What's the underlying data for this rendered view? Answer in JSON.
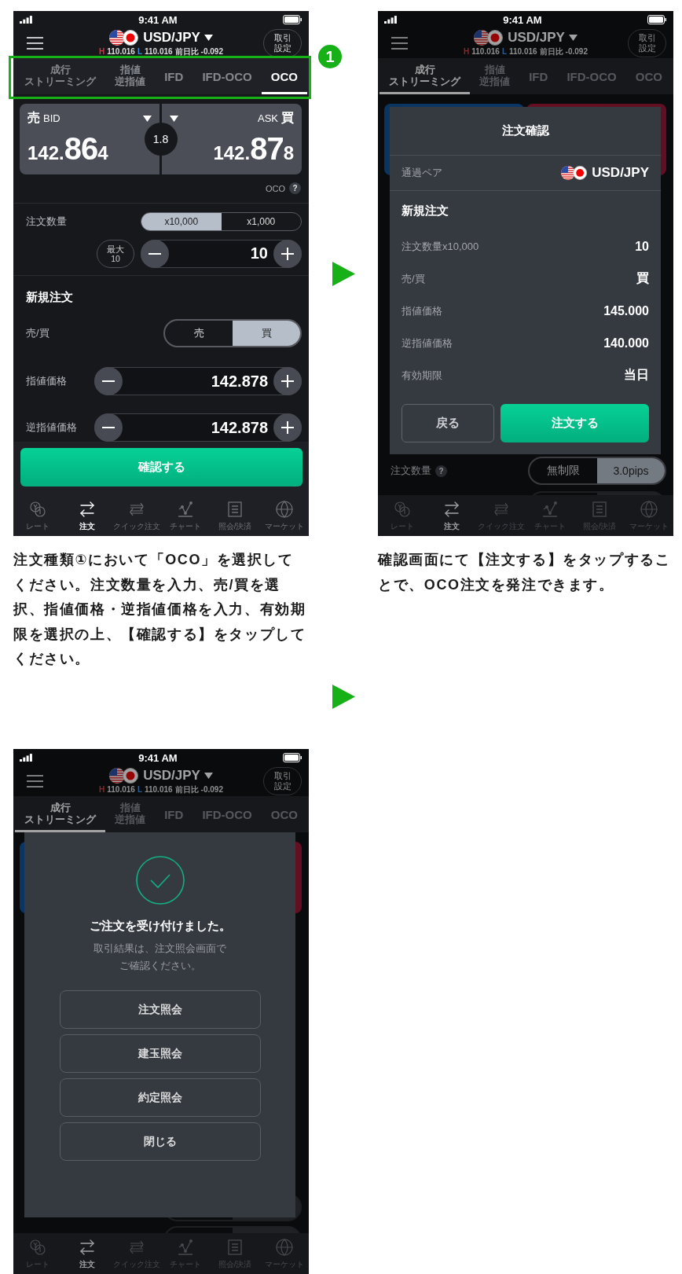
{
  "screens": [
    {
      "kind": "order",
      "status_bar": {
        "time": "9:41 AM"
      },
      "header": {
        "pair": "USD/JPY",
        "high_label": "H",
        "high": "110.016",
        "low_label": "L",
        "low": "110.016",
        "change_label": "前日比",
        "change": "-0.092",
        "settings": [
          "取引",
          "設定"
        ]
      },
      "tabs": [
        {
          "lines": [
            "成行",
            "ストリーミング"
          ],
          "selected": false
        },
        {
          "lines": [
            "指値",
            "逆指値"
          ],
          "selected": false
        },
        {
          "lines": [
            "IFD"
          ],
          "selected": false
        },
        {
          "lines": [
            "IFD-OCO"
          ],
          "selected": false
        },
        {
          "lines": [
            "OCO"
          ],
          "selected": true
        }
      ],
      "annotation": {
        "badge": "1"
      },
      "quote": {
        "bid": {
          "side": "売",
          "label": "BID",
          "price": [
            "142.",
            "86",
            "4"
          ]
        },
        "spread": "1.8",
        "ask": {
          "label": "ASK",
          "side": "買",
          "price": [
            "142.",
            "87",
            "8"
          ]
        }
      },
      "help": {
        "label": "OCO",
        "icon": "?"
      },
      "quantity": {
        "label": "注文数量",
        "units": [
          {
            "label": "x10,000",
            "selected": true
          },
          {
            "label": "x1,000",
            "selected": false
          }
        ],
        "max": [
          "最大",
          "10"
        ],
        "value": "10"
      },
      "section": "新規注文",
      "side": {
        "label": "売/買",
        "options": [
          {
            "label": "売",
            "selected": false
          },
          {
            "label": "買",
            "selected": true
          }
        ]
      },
      "prices": [
        {
          "label": "指値価格",
          "value": "142.878"
        },
        {
          "label": "逆指値価格",
          "value": "142.878"
        }
      ],
      "confirm_button": "確認する",
      "nav": [
        {
          "label": "レート",
          "selected": false
        },
        {
          "label": "注文",
          "selected": true
        },
        {
          "label": "クイック注文",
          "selected": false
        },
        {
          "label": "チャート",
          "selected": false
        },
        {
          "label": "照会/決済",
          "selected": false
        },
        {
          "label": "マーケット",
          "selected": false
        }
      ]
    },
    {
      "kind": "confirm",
      "status_bar": {
        "time": "9:41 AM"
      },
      "header": {
        "pair": "USD/JPY",
        "high_label": "H",
        "high": "110.016",
        "low_label": "L",
        "low": "110.016",
        "change_label": "前日比",
        "change": "-0.092",
        "settings": [
          "取引",
          "設定"
        ]
      },
      "tabs": [
        {
          "lines": [
            "成行",
            "ストリーミング"
          ],
          "selected": true
        },
        {
          "lines": [
            "指値",
            "逆指値"
          ],
          "selected": false
        },
        {
          "lines": [
            "IFD"
          ],
          "selected": false
        },
        {
          "lines": [
            "IFD-OCO"
          ],
          "selected": false
        },
        {
          "lines": [
            "OCO"
          ],
          "selected": false
        }
      ],
      "background": {
        "label": "注文数量",
        "help_icon": "?",
        "options": [
          {
            "label": "無制限",
            "selected": false
          },
          {
            "label": "3.0pips",
            "selected": true
          }
        ]
      },
      "dialog": {
        "title": "注文確認",
        "pair_label": "通過ペア",
        "pair": "USD/JPY",
        "section": "新規注文",
        "rows": [
          {
            "label": "注文数量x10,000",
            "value": "10"
          },
          {
            "label": "売/買",
            "value": "買"
          },
          {
            "label": "指値価格",
            "value": "145.000"
          },
          {
            "label": "逆指値価格",
            "value": "140.000"
          },
          {
            "label": "有効期限",
            "value": "当日"
          }
        ],
        "buttons": [
          {
            "label": "戻る",
            "kind": "secondary"
          },
          {
            "label": "注文する",
            "kind": "primary"
          }
        ]
      },
      "nav": [
        {
          "label": "レート",
          "selected": false
        },
        {
          "label": "注文",
          "selected": true
        },
        {
          "label": "クイック注文",
          "selected": false
        },
        {
          "label": "チャート",
          "selected": false
        },
        {
          "label": "照会/決済",
          "selected": false
        },
        {
          "label": "マーケット",
          "selected": false
        }
      ]
    },
    {
      "kind": "complete",
      "status_bar": {
        "time": "9:41 AM"
      },
      "header": {
        "pair": "USD/JPY",
        "high_label": "H",
        "high": "110.016",
        "low_label": "L",
        "low": "110.016",
        "change_label": "前日比",
        "change": "-0.092",
        "settings": [
          "取引",
          "設定"
        ]
      },
      "tabs": [
        {
          "lines": [
            "成行",
            "ストリーミング"
          ],
          "selected": true
        },
        {
          "lines": [
            "指値",
            "逆指値"
          ],
          "selected": false
        },
        {
          "lines": [
            "IFD"
          ],
          "selected": false
        },
        {
          "lines": [
            "IFD-OCO"
          ],
          "selected": false
        },
        {
          "lines": [
            "OCO"
          ],
          "selected": false
        }
      ],
      "dialog": {
        "title": "ご注文を受け付けました。",
        "message": [
          "取引結果は、注文照会画面で",
          "ご確認ください。"
        ],
        "buttons": [
          {
            "label": "注文照会",
            "kind": "secondary"
          },
          {
            "label": "建玉照会",
            "kind": "secondary"
          },
          {
            "label": "約定照会",
            "kind": "secondary"
          },
          {
            "label": "閉じる",
            "kind": "secondary"
          }
        ]
      },
      "nav": [
        {
          "label": "レート",
          "selected": false
        },
        {
          "label": "注文",
          "selected": true
        },
        {
          "label": "クイック注文",
          "selected": false
        },
        {
          "label": "チャート",
          "selected": false
        },
        {
          "label": "照会/決済",
          "selected": false
        },
        {
          "label": "マーケット",
          "selected": false
        }
      ]
    }
  ],
  "captions": [
    "注文種類①において「OCO」を選択してください。注文数量を入力、売/買を選択、指値価格・逆指値価格を入力、有効期限を選択の上、【確認する】をタップしてください。",
    "確認画面にて【注文する】をタップすることで、OCO注文を発注できます。"
  ]
}
